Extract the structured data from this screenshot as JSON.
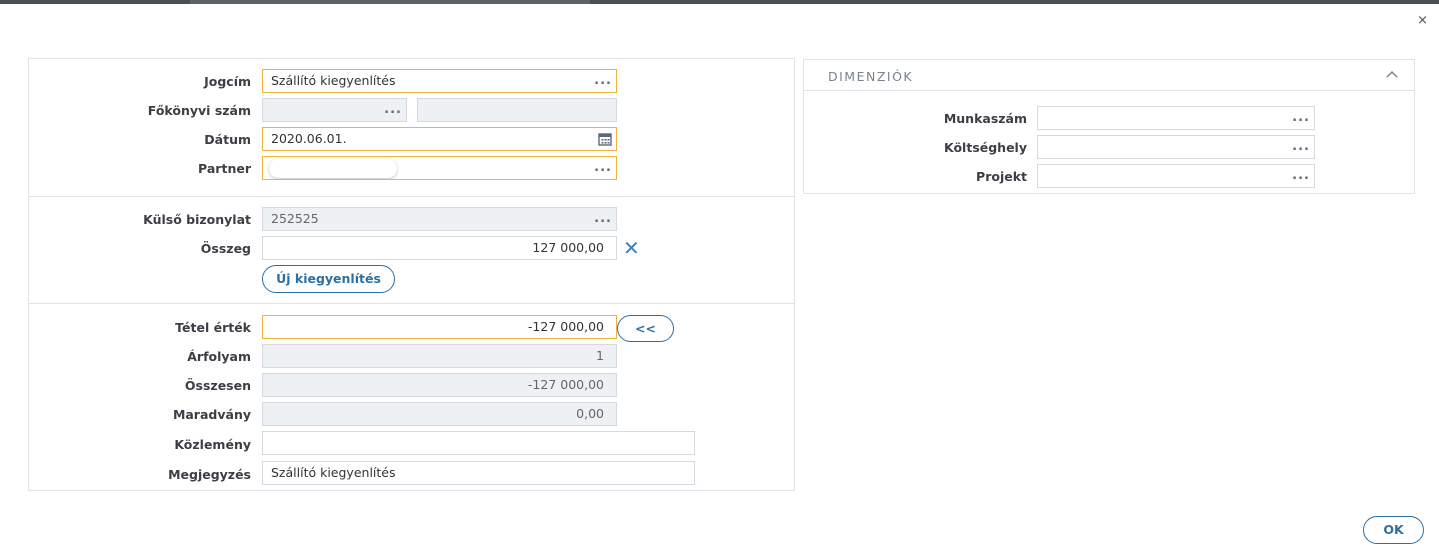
{
  "window": {
    "close_glyph": "×"
  },
  "form": {
    "jogcim": {
      "label": "Jogcím",
      "value": "Szállító kiegyenlítés"
    },
    "fokonyvi": {
      "label": "Főkönyvi szám",
      "value1": "",
      "value2": ""
    },
    "datum": {
      "label": "Dátum",
      "value": "2020.06.01."
    },
    "partner": {
      "label": "Partner",
      "value": ""
    },
    "kulso": {
      "label": "Külső bizonylat",
      "value": "252525"
    },
    "osszeg": {
      "label": "Összeg",
      "value": "127 000,00",
      "clear_glyph": "✕"
    },
    "uj_button": "Új kiegyenlítés",
    "tetel": {
      "label": "Tétel érték",
      "value": "-127 000,00"
    },
    "copy_button": "<<",
    "arfolyam": {
      "label": "Árfolyam",
      "value": "1"
    },
    "osszesen": {
      "label": "Összesen",
      "value": "-127 000,00"
    },
    "maradvany": {
      "label": "Maradvány",
      "value": "0,00"
    },
    "kozlemeny": {
      "label": "Közlemény",
      "value": ""
    },
    "megjegyzes": {
      "label": "Megjegyzés",
      "value": "Szállító kiegyenlítés"
    }
  },
  "dimensions": {
    "title": "DIMENZIÓK",
    "munkaszam": {
      "label": "Munkaszám",
      "value": ""
    },
    "koltseghely": {
      "label": "Költséghely",
      "value": ""
    },
    "projekt": {
      "label": "Projekt",
      "value": ""
    }
  },
  "ok_button": "OK",
  "lookup_glyph": "...",
  "colors": {
    "active_border": "#f0b43c",
    "accent_blue": "#2d6fa3",
    "disabled_bg": "#eef1f4"
  },
  "icons": {
    "lookup": "more-dots-icon",
    "calendar": "calendar-icon",
    "collapse": "chevron-up-icon",
    "clear": "clear-x-icon",
    "close": "close-icon"
  }
}
